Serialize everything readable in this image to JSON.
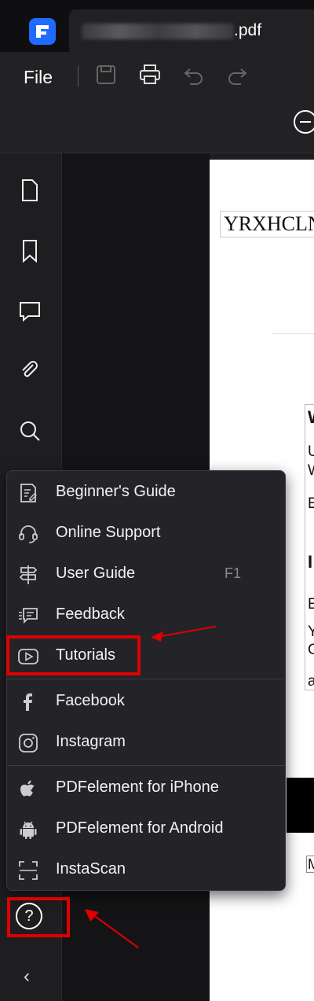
{
  "window": {
    "tab_title": ".pdf"
  },
  "toolbar": {
    "file_label": "File"
  },
  "document": {
    "header_text": "YRXHCLN",
    "side_letters": [
      "W",
      "U",
      "W",
      "E",
      "I",
      "E",
      "Y",
      "C",
      "a"
    ],
    "bottom_letter": "M"
  },
  "help_menu": {
    "items": [
      {
        "label": "Beginner's Guide",
        "icon": "guide-icon"
      },
      {
        "label": "Online Support",
        "icon": "headset-icon"
      },
      {
        "label": "User Guide",
        "icon": "signpost-icon",
        "shortcut": "F1"
      },
      {
        "label": "Feedback",
        "icon": "feedback-icon"
      },
      {
        "label": "Tutorials",
        "icon": "play-icon"
      },
      {
        "label": "Facebook",
        "icon": "facebook-icon"
      },
      {
        "label": "Instagram",
        "icon": "instagram-icon"
      },
      {
        "label": "PDFelement for iPhone",
        "icon": "apple-icon"
      },
      {
        "label": "PDFelement for Android",
        "icon": "android-icon"
      },
      {
        "label": "InstaScan",
        "icon": "scan-icon"
      }
    ]
  },
  "help_button": {
    "glyph": "?"
  },
  "collapse_button": {
    "glyph": "‹"
  },
  "colors": {
    "accent": "#1f6bff",
    "annotation": "#e00000",
    "menu_bg": "#242428"
  }
}
